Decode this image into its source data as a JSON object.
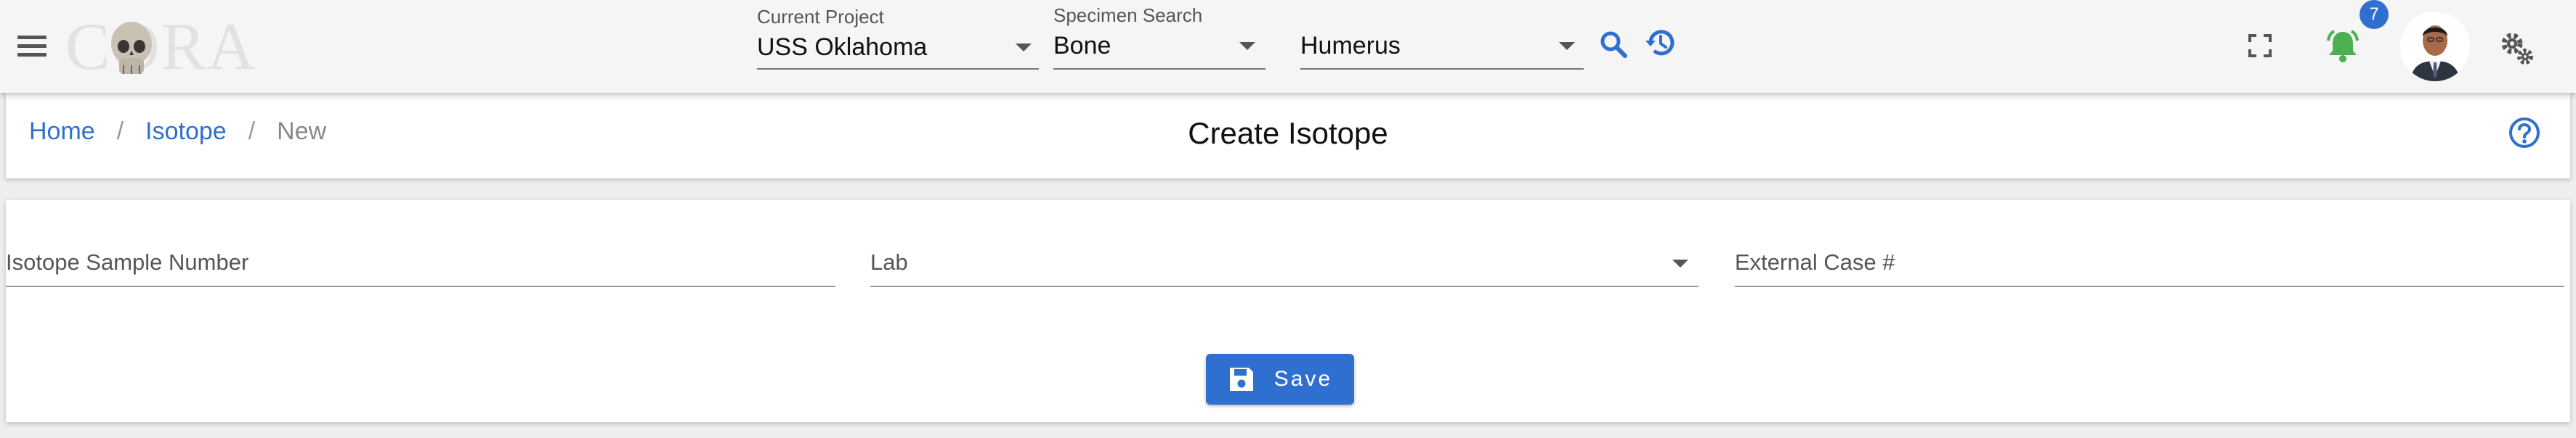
{
  "app": {
    "logo_text": "CORA"
  },
  "header": {
    "project": {
      "label": "Current Project",
      "value": "USS Oklahoma"
    },
    "specimen": {
      "label": "Specimen Search",
      "value": "Bone"
    },
    "element": {
      "value": "Humerus"
    },
    "notifications": {
      "count": "7"
    },
    "icons": [
      "menu-icon",
      "search-icon",
      "history-icon",
      "fullscreen-icon",
      "bell-icon",
      "avatar",
      "settings-icon"
    ],
    "colors": {
      "accent": "#2f6fcf",
      "bell": "#4caf50"
    }
  },
  "breadcrumb": {
    "home": "Home",
    "isotope": "Isotope",
    "current": "New"
  },
  "page": {
    "title": "Create Isotope",
    "help_icon": "help-icon"
  },
  "form": {
    "sample_number_placeholder": "Isotope Sample Number",
    "lab_placeholder": "Lab",
    "external_case_placeholder": "External Case #",
    "save_label": "Save",
    "save_icon": "floppy-disk-icon"
  }
}
